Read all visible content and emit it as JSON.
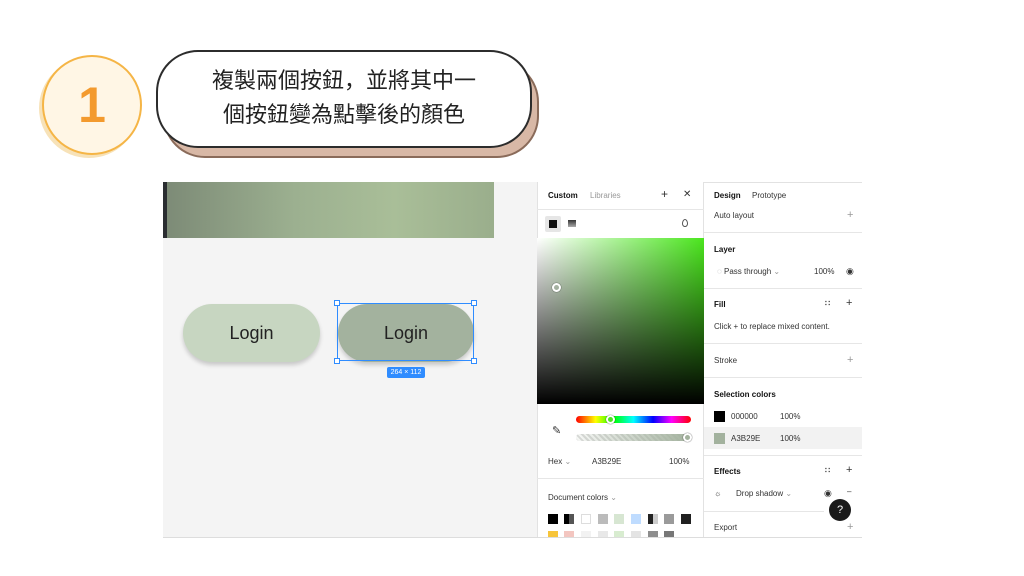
{
  "step": {
    "number": "1",
    "lines": [
      "複製兩個按鈕，並將其中一",
      "個按鈕變為點擊後的顏色"
    ]
  },
  "canvas": {
    "button1_label": "Login",
    "button2_label": "Login",
    "dimensions": "264 × 112"
  },
  "picker": {
    "tab_custom": "Custom",
    "tab_libraries": "Libraries",
    "plus": "+",
    "close": "✕",
    "format": "Hex",
    "hex": "A3B29E",
    "opacity": "100%",
    "doc_colors": "Document colors",
    "swatches_row1": [
      "#000000",
      "#111111",
      "#ffffff",
      "#bbbbbb",
      "#d7e6d2",
      "#bfdcff",
      "#cfcfcf",
      "#9a9a9a",
      "#202020"
    ],
    "swatches_row2": [
      "#f7c53b",
      "#f3c6c0",
      "#f2f2f2",
      "#e8e8e8",
      "#d8ecd0",
      "#e4e4e4",
      "#8d8d8d",
      "#777777"
    ]
  },
  "design": {
    "tab_design": "Design",
    "tab_prototype": "Prototype",
    "auto_layout": "Auto layout",
    "layer": "Layer",
    "blend": "Pass through",
    "layer_opacity": "100%",
    "fill": "Fill",
    "fill_hint": "Click + to replace mixed content.",
    "stroke": "Stroke",
    "selection_colors": "Selection colors",
    "colors": [
      {
        "hex": "000000",
        "opacity": "100%",
        "swatch": "#000000"
      },
      {
        "hex": "A3B29E",
        "opacity": "100%",
        "swatch": "#a3b29e"
      }
    ],
    "effects": "Effects",
    "effect_name": "Drop shadow",
    "export": "Export",
    "help": "?"
  },
  "colors": {
    "accent": "#2f8cff",
    "step_orange": "#f39a2e",
    "button_default": "#c7d6c1",
    "button_pressed": "#a3b29e"
  }
}
